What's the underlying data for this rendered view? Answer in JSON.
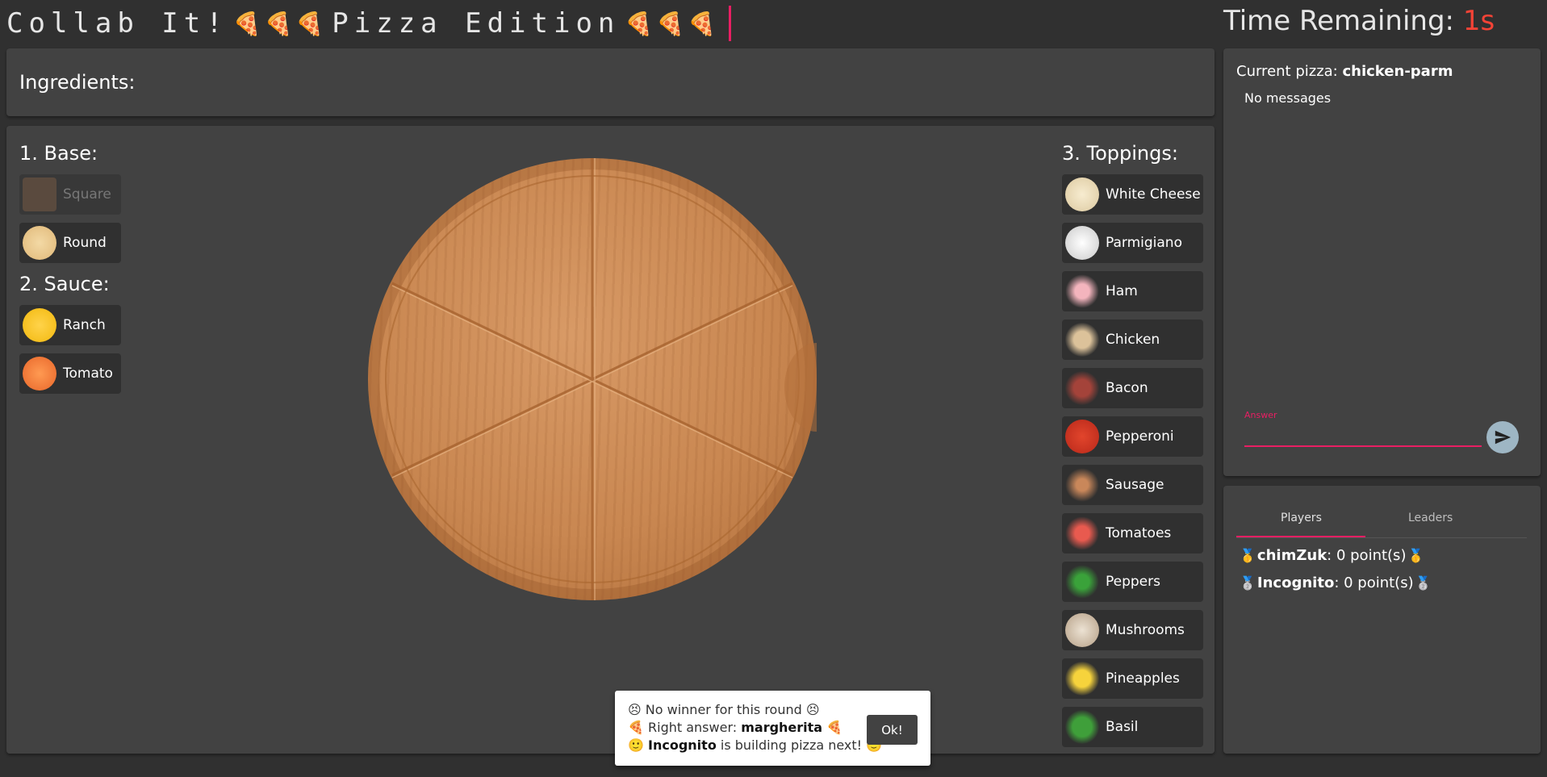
{
  "header": {
    "title_prefix": "Collab It!",
    "pizza_emoji": "🍕🍕🍕",
    "title_suffix": "Pizza Edition",
    "timer_label": "Time Remaining:",
    "timer_value": "1s"
  },
  "ingredients": {
    "label": "Ingredients:"
  },
  "builder": {
    "base_title": "1. Base:",
    "base": [
      {
        "label": "Square",
        "icon": "square-dough-icon",
        "enabled": false
      },
      {
        "label": "Round",
        "icon": "round-dough-icon",
        "enabled": true
      }
    ],
    "sauce_title": "2. Sauce:",
    "sauce": [
      {
        "label": "Ranch",
        "icon": "ranch-icon"
      },
      {
        "label": "Tomato",
        "icon": "tomato-sauce-icon"
      }
    ],
    "toppings_title": "3. Toppings:",
    "toppings": [
      {
        "label": "White Cheese",
        "icon": "white-cheese-icon"
      },
      {
        "label": "Parmigiano",
        "icon": "parmigiano-icon"
      },
      {
        "label": "Ham",
        "icon": "ham-icon"
      },
      {
        "label": "Chicken",
        "icon": "chicken-icon"
      },
      {
        "label": "Bacon",
        "icon": "bacon-icon"
      },
      {
        "label": "Pepperoni",
        "icon": "pepperoni-icon"
      },
      {
        "label": "Sausage",
        "icon": "sausage-icon"
      },
      {
        "label": "Tomatoes",
        "icon": "tomatoes-icon"
      },
      {
        "label": "Peppers",
        "icon": "peppers-icon"
      },
      {
        "label": "Mushrooms",
        "icon": "mushrooms-icon"
      },
      {
        "label": "Pineapples",
        "icon": "pineapples-icon"
      },
      {
        "label": "Basil",
        "icon": "basil-icon"
      }
    ]
  },
  "chat": {
    "current_label": "Current pizza:",
    "current_value": "chicken-parm",
    "no_messages": "No messages",
    "answer_label": "Answer",
    "answer_value": ""
  },
  "players": {
    "tabs": [
      "Players",
      "Leaders"
    ],
    "list": [
      {
        "name": "chimZuk",
        "points": ": 0 point(s)",
        "medal": "🥇"
      },
      {
        "name": "Incognito",
        "points": ": 0 point(s)",
        "medal": "🥈"
      }
    ]
  },
  "toast": {
    "line1": "No winner for this round",
    "line2_prefix": "Right answer: ",
    "line2_value": "margherita",
    "line3_name": "Incognito",
    "line3_suffix": " is building pizza next!",
    "ok_label": "Ok!"
  },
  "colors": {
    "accent": "#e91e63",
    "timer": "#f44336",
    "panel": "#424242",
    "bg": "#303030"
  }
}
